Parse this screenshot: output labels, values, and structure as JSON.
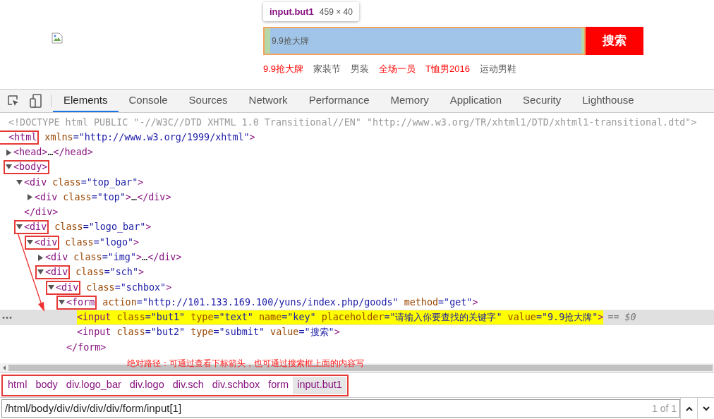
{
  "page_preview": {
    "tooltip": {
      "selector": "input.but1",
      "size": "459 × 40"
    },
    "search": {
      "value": "9.9抢大牌",
      "button": "搜索"
    },
    "hot_words": [
      {
        "text": "9.9抢大牌",
        "color": "#ff0000"
      },
      {
        "text": "家装节",
        "color": "#555555"
      },
      {
        "text": "男装",
        "color": "#555555"
      },
      {
        "text": "全场一员",
        "color": "#ff0000"
      },
      {
        "text": "T恤男2016",
        "color": "#ff0000"
      },
      {
        "text": "运动男鞋",
        "color": "#555555"
      }
    ]
  },
  "devtools": {
    "tabs": [
      {
        "label": "Elements",
        "selected": true
      },
      {
        "label": "Console",
        "selected": false
      },
      {
        "label": "Sources",
        "selected": false
      },
      {
        "label": "Network",
        "selected": false
      },
      {
        "label": "Performance",
        "selected": false
      },
      {
        "label": "Memory",
        "selected": false
      },
      {
        "label": "Application",
        "selected": false
      },
      {
        "label": "Security",
        "selected": false
      },
      {
        "label": "Lighthouse",
        "selected": false
      }
    ],
    "elements": [
      {
        "boxed": false,
        "selected": false,
        "tokens": [
          {
            "kind": "comment",
            "t": "<!DOCTYPE html PUBLIC \"-//W3C//DTD XHTML 1.0 Transitional//EN\" \"http://www.w3.org/TR/xhtml1/DTD/xhtml1-transitional.dtd\">"
          }
        ]
      },
      {
        "boxed": true,
        "selected": false,
        "tokens": [
          {
            "kind": "tag",
            "t": "<html"
          },
          {
            "kind": "attr",
            "t": " xmlns"
          },
          {
            "kind": "val",
            "t": "=\"http://www.w3.org/1999/xhtml\""
          },
          {
            "kind": "tag",
            "t": ">"
          }
        ],
        "children": [
          {
            "kind": "collapsed",
            "boxed": false,
            "selected": false,
            "tokens": [
              {
                "kind": "tag",
                "t": "<head>"
              },
              {
                "kind": "plain",
                "t": "…"
              },
              {
                "kind": "tag",
                "t": "</head>"
              }
            ]
          },
          {
            "kind": "expanded",
            "boxed": true,
            "selected": false,
            "tokens": [
              {
                "kind": "tag",
                "t": "<body>"
              }
            ],
            "children": [
              {
                "kind": "expanded",
                "boxed": false,
                "selected": false,
                "tokens": [
                  {
                    "kind": "tag",
                    "t": "<div"
                  },
                  {
                    "kind": "attr",
                    "t": " class"
                  },
                  {
                    "kind": "val",
                    "t": "=\"top_bar\""
                  },
                  {
                    "kind": "tag",
                    "t": ">"
                  }
                ],
                "children": [
                  {
                    "kind": "collapsed",
                    "boxed": false,
                    "selected": false,
                    "tokens": [
                      {
                        "kind": "tag",
                        "t": "<div"
                      },
                      {
                        "kind": "attr",
                        "t": " class"
                      },
                      {
                        "kind": "val",
                        "t": "=\"top\""
                      },
                      {
                        "kind": "tag",
                        "t": ">"
                      },
                      {
                        "kind": "plain",
                        "t": "…"
                      },
                      {
                        "kind": "tag",
                        "t": "</div>"
                      }
                    ]
                  }
                ]
              },
              {
                "boxed": false,
                "selected": false,
                "tokens": [
                  {
                    "kind": "tag",
                    "t": "</div>"
                  }
                ]
              },
              {
                "kind": "expanded",
                "boxed": true,
                "selected": false,
                "tokens": [
                  {
                    "kind": "tag",
                    "t": "<div"
                  },
                  {
                    "kind": "attr",
                    "t": " class"
                  },
                  {
                    "kind": "val",
                    "t": "=\"logo_bar\""
                  },
                  {
                    "kind": "tag",
                    "t": ">"
                  }
                ],
                "children": [
                  {
                    "kind": "expanded",
                    "boxed": true,
                    "selected": false,
                    "tokens": [
                      {
                        "kind": "tag",
                        "t": "<div"
                      },
                      {
                        "kind": "attr",
                        "t": " class"
                      },
                      {
                        "kind": "val",
                        "t": "=\"logo\""
                      },
                      {
                        "kind": "tag",
                        "t": ">"
                      }
                    ],
                    "children": [
                      {
                        "kind": "collapsed",
                        "boxed": false,
                        "selected": false,
                        "tokens": [
                          {
                            "kind": "tag",
                            "t": "<div"
                          },
                          {
                            "kind": "attr",
                            "t": " class"
                          },
                          {
                            "kind": "val",
                            "t": "=\"img\""
                          },
                          {
                            "kind": "tag",
                            "t": ">"
                          },
                          {
                            "kind": "plain",
                            "t": "…"
                          },
                          {
                            "kind": "tag",
                            "t": "</div>"
                          }
                        ]
                      },
                      {
                        "kind": "expanded",
                        "boxed": true,
                        "selected": false,
                        "tokens": [
                          {
                            "kind": "tag",
                            "t": "<div"
                          },
                          {
                            "kind": "attr",
                            "t": " class"
                          },
                          {
                            "kind": "val",
                            "t": "=\"sch\""
                          },
                          {
                            "kind": "tag",
                            "t": ">"
                          }
                        ],
                        "children": [
                          {
                            "kind": "expanded",
                            "boxed": true,
                            "selected": false,
                            "tokens": [
                              {
                                "kind": "tag",
                                "t": "<div"
                              },
                              {
                                "kind": "attr",
                                "t": " class"
                              },
                              {
                                "kind": "val",
                                "t": "=\"schbox\""
                              },
                              {
                                "kind": "tag",
                                "t": ">"
                              }
                            ],
                            "children": [
                              {
                                "kind": "expanded",
                                "boxed": true,
                                "selected": false,
                                "tokens": [
                                  {
                                    "kind": "tag",
                                    "t": "<form"
                                  },
                                  {
                                    "kind": "attr",
                                    "t": " action"
                                  },
                                  {
                                    "kind": "val",
                                    "t": "=\"http://101.133.169.100/yuns/index.php/goods\""
                                  },
                                  {
                                    "kind": "attr",
                                    "t": " method"
                                  },
                                  {
                                    "kind": "val",
                                    "t": "=\"get\""
                                  },
                                  {
                                    "kind": "tag",
                                    "t": ">"
                                  }
                                ],
                                "children": [
                                  {
                                    "boxed": false,
                                    "selected": true,
                                    "gutter": "•••",
                                    "suffix": "== $0",
                                    "tokens": [
                                      {
                                        "kind": "tag",
                                        "t": "<input"
                                      },
                                      {
                                        "kind": "attr",
                                        "t": " class"
                                      },
                                      {
                                        "kind": "val",
                                        "t": "=\"but1\""
                                      },
                                      {
                                        "kind": "attr",
                                        "t": " type"
                                      },
                                      {
                                        "kind": "val",
                                        "t": "=\"text\""
                                      },
                                      {
                                        "kind": "attr",
                                        "t": " name"
                                      },
                                      {
                                        "kind": "val",
                                        "t": "=\"key\""
                                      },
                                      {
                                        "kind": "attr",
                                        "t": " placeholder"
                                      },
                                      {
                                        "kind": "val",
                                        "t": "=\"请输入你要查找的关键字\""
                                      },
                                      {
                                        "kind": "attr",
                                        "t": " value"
                                      },
                                      {
                                        "kind": "val",
                                        "t": "=\"9.9抢大牌\""
                                      },
                                      {
                                        "kind": "tag",
                                        "t": ">"
                                      }
                                    ]
                                  },
                                  {
                                    "boxed": false,
                                    "selected": false,
                                    "tokens": [
                                      {
                                        "kind": "tag",
                                        "t": "<input"
                                      },
                                      {
                                        "kind": "attr",
                                        "t": " class"
                                      },
                                      {
                                        "kind": "val",
                                        "t": "=\"but2\""
                                      },
                                      {
                                        "kind": "attr",
                                        "t": " type"
                                      },
                                      {
                                        "kind": "val",
                                        "t": "=\"submit\""
                                      },
                                      {
                                        "kind": "attr",
                                        "t": " value"
                                      },
                                      {
                                        "kind": "val",
                                        "t": "=\"搜索\""
                                      },
                                      {
                                        "kind": "tag",
                                        "t": ">"
                                      }
                                    ]
                                  }
                                ]
                              },
                              {
                                "boxed": false,
                                "selected": false,
                                "tokens": [
                                  {
                                    "kind": "tag",
                                    "t": "</form>"
                                  }
                                ]
                              }
                            ]
                          }
                        ]
                      }
                    ]
                  }
                ]
              }
            ]
          }
        ]
      }
    ],
    "annotation": "绝对路径：可通过查看下标箭头，也可通过搜索框上面的内容写",
    "breadcrumbs": [
      {
        "label": "html",
        "selected": false
      },
      {
        "label": "body",
        "selected": false
      },
      {
        "label": "div.logo_bar",
        "selected": false
      },
      {
        "label": "div.logo",
        "selected": false
      },
      {
        "label": "div.sch",
        "selected": false
      },
      {
        "label": "div.schbox",
        "selected": false
      },
      {
        "label": "form",
        "selected": false
      },
      {
        "label": "input.but1",
        "selected": true
      }
    ],
    "search": {
      "value": "/html/body/div/div/div/div/form/input[1]",
      "count": "1 of 1"
    }
  }
}
